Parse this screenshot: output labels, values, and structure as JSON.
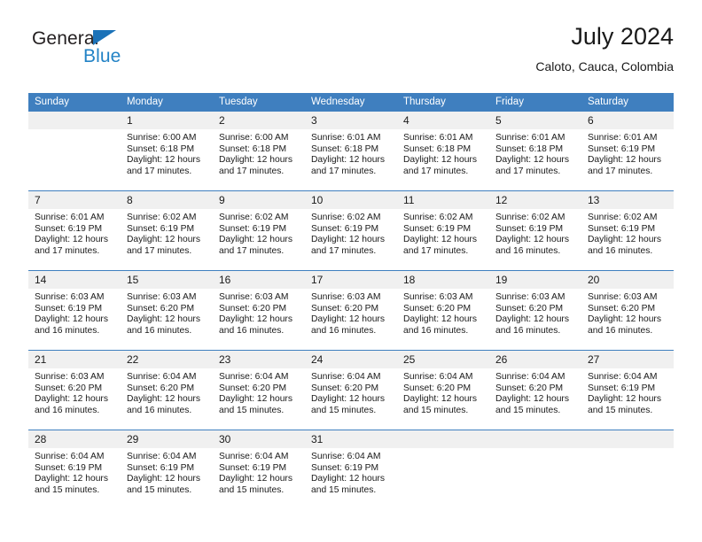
{
  "brand": {
    "name_part1": "General",
    "name_part2": "Blue",
    "triangle_color": "#1b72b8",
    "blue_color": "#2383c6"
  },
  "header": {
    "title": "July 2024",
    "subtitle": "Caloto, Cauca, Colombia"
  },
  "theme": {
    "header_bg": "#3f7fbf",
    "daynum_bg": "#f0f0f0",
    "separator": "#3f7fbf",
    "text": "#1a1a1a"
  },
  "weekday_headers": [
    "Sunday",
    "Monday",
    "Tuesday",
    "Wednesday",
    "Thursday",
    "Friday",
    "Saturday"
  ],
  "labels": {
    "sunrise_prefix": "Sunrise:",
    "sunset_prefix": "Sunset:",
    "daylight_prefix": "Daylight:"
  },
  "weeks": [
    {
      "days": [
        {
          "num": "",
          "blank": true,
          "sunrise": "",
          "sunset": "",
          "daylight": ""
        },
        {
          "num": "1",
          "blank": false,
          "sunrise": "Sunrise: 6:00 AM",
          "sunset": "Sunset: 6:18 PM",
          "daylight": "Daylight: 12 hours and 17 minutes."
        },
        {
          "num": "2",
          "blank": false,
          "sunrise": "Sunrise: 6:00 AM",
          "sunset": "Sunset: 6:18 PM",
          "daylight": "Daylight: 12 hours and 17 minutes."
        },
        {
          "num": "3",
          "blank": false,
          "sunrise": "Sunrise: 6:01 AM",
          "sunset": "Sunset: 6:18 PM",
          "daylight": "Daylight: 12 hours and 17 minutes."
        },
        {
          "num": "4",
          "blank": false,
          "sunrise": "Sunrise: 6:01 AM",
          "sunset": "Sunset: 6:18 PM",
          "daylight": "Daylight: 12 hours and 17 minutes."
        },
        {
          "num": "5",
          "blank": false,
          "sunrise": "Sunrise: 6:01 AM",
          "sunset": "Sunset: 6:18 PM",
          "daylight": "Daylight: 12 hours and 17 minutes."
        },
        {
          "num": "6",
          "blank": false,
          "sunrise": "Sunrise: 6:01 AM",
          "sunset": "Sunset: 6:19 PM",
          "daylight": "Daylight: 12 hours and 17 minutes."
        }
      ]
    },
    {
      "days": [
        {
          "num": "7",
          "blank": false,
          "sunrise": "Sunrise: 6:01 AM",
          "sunset": "Sunset: 6:19 PM",
          "daylight": "Daylight: 12 hours and 17 minutes."
        },
        {
          "num": "8",
          "blank": false,
          "sunrise": "Sunrise: 6:02 AM",
          "sunset": "Sunset: 6:19 PM",
          "daylight": "Daylight: 12 hours and 17 minutes."
        },
        {
          "num": "9",
          "blank": false,
          "sunrise": "Sunrise: 6:02 AM",
          "sunset": "Sunset: 6:19 PM",
          "daylight": "Daylight: 12 hours and 17 minutes."
        },
        {
          "num": "10",
          "blank": false,
          "sunrise": "Sunrise: 6:02 AM",
          "sunset": "Sunset: 6:19 PM",
          "daylight": "Daylight: 12 hours and 17 minutes."
        },
        {
          "num": "11",
          "blank": false,
          "sunrise": "Sunrise: 6:02 AM",
          "sunset": "Sunset: 6:19 PM",
          "daylight": "Daylight: 12 hours and 17 minutes."
        },
        {
          "num": "12",
          "blank": false,
          "sunrise": "Sunrise: 6:02 AM",
          "sunset": "Sunset: 6:19 PM",
          "daylight": "Daylight: 12 hours and 16 minutes."
        },
        {
          "num": "13",
          "blank": false,
          "sunrise": "Sunrise: 6:02 AM",
          "sunset": "Sunset: 6:19 PM",
          "daylight": "Daylight: 12 hours and 16 minutes."
        }
      ]
    },
    {
      "days": [
        {
          "num": "14",
          "blank": false,
          "sunrise": "Sunrise: 6:03 AM",
          "sunset": "Sunset: 6:19 PM",
          "daylight": "Daylight: 12 hours and 16 minutes."
        },
        {
          "num": "15",
          "blank": false,
          "sunrise": "Sunrise: 6:03 AM",
          "sunset": "Sunset: 6:20 PM",
          "daylight": "Daylight: 12 hours and 16 minutes."
        },
        {
          "num": "16",
          "blank": false,
          "sunrise": "Sunrise: 6:03 AM",
          "sunset": "Sunset: 6:20 PM",
          "daylight": "Daylight: 12 hours and 16 minutes."
        },
        {
          "num": "17",
          "blank": false,
          "sunrise": "Sunrise: 6:03 AM",
          "sunset": "Sunset: 6:20 PM",
          "daylight": "Daylight: 12 hours and 16 minutes."
        },
        {
          "num": "18",
          "blank": false,
          "sunrise": "Sunrise: 6:03 AM",
          "sunset": "Sunset: 6:20 PM",
          "daylight": "Daylight: 12 hours and 16 minutes."
        },
        {
          "num": "19",
          "blank": false,
          "sunrise": "Sunrise: 6:03 AM",
          "sunset": "Sunset: 6:20 PM",
          "daylight": "Daylight: 12 hours and 16 minutes."
        },
        {
          "num": "20",
          "blank": false,
          "sunrise": "Sunrise: 6:03 AM",
          "sunset": "Sunset: 6:20 PM",
          "daylight": "Daylight: 12 hours and 16 minutes."
        }
      ]
    },
    {
      "days": [
        {
          "num": "21",
          "blank": false,
          "sunrise": "Sunrise: 6:03 AM",
          "sunset": "Sunset: 6:20 PM",
          "daylight": "Daylight: 12 hours and 16 minutes."
        },
        {
          "num": "22",
          "blank": false,
          "sunrise": "Sunrise: 6:04 AM",
          "sunset": "Sunset: 6:20 PM",
          "daylight": "Daylight: 12 hours and 16 minutes."
        },
        {
          "num": "23",
          "blank": false,
          "sunrise": "Sunrise: 6:04 AM",
          "sunset": "Sunset: 6:20 PM",
          "daylight": "Daylight: 12 hours and 15 minutes."
        },
        {
          "num": "24",
          "blank": false,
          "sunrise": "Sunrise: 6:04 AM",
          "sunset": "Sunset: 6:20 PM",
          "daylight": "Daylight: 12 hours and 15 minutes."
        },
        {
          "num": "25",
          "blank": false,
          "sunrise": "Sunrise: 6:04 AM",
          "sunset": "Sunset: 6:20 PM",
          "daylight": "Daylight: 12 hours and 15 minutes."
        },
        {
          "num": "26",
          "blank": false,
          "sunrise": "Sunrise: 6:04 AM",
          "sunset": "Sunset: 6:20 PM",
          "daylight": "Daylight: 12 hours and 15 minutes."
        },
        {
          "num": "27",
          "blank": false,
          "sunrise": "Sunrise: 6:04 AM",
          "sunset": "Sunset: 6:19 PM",
          "daylight": "Daylight: 12 hours and 15 minutes."
        }
      ]
    },
    {
      "days": [
        {
          "num": "28",
          "blank": false,
          "sunrise": "Sunrise: 6:04 AM",
          "sunset": "Sunset: 6:19 PM",
          "daylight": "Daylight: 12 hours and 15 minutes."
        },
        {
          "num": "29",
          "blank": false,
          "sunrise": "Sunrise: 6:04 AM",
          "sunset": "Sunset: 6:19 PM",
          "daylight": "Daylight: 12 hours and 15 minutes."
        },
        {
          "num": "30",
          "blank": false,
          "sunrise": "Sunrise: 6:04 AM",
          "sunset": "Sunset: 6:19 PM",
          "daylight": "Daylight: 12 hours and 15 minutes."
        },
        {
          "num": "31",
          "blank": false,
          "sunrise": "Sunrise: 6:04 AM",
          "sunset": "Sunset: 6:19 PM",
          "daylight": "Daylight: 12 hours and 15 minutes."
        },
        {
          "num": "",
          "blank": true,
          "sunrise": "",
          "sunset": "",
          "daylight": ""
        },
        {
          "num": "",
          "blank": true,
          "sunrise": "",
          "sunset": "",
          "daylight": ""
        },
        {
          "num": "",
          "blank": true,
          "sunrise": "",
          "sunset": "",
          "daylight": ""
        }
      ]
    }
  ]
}
